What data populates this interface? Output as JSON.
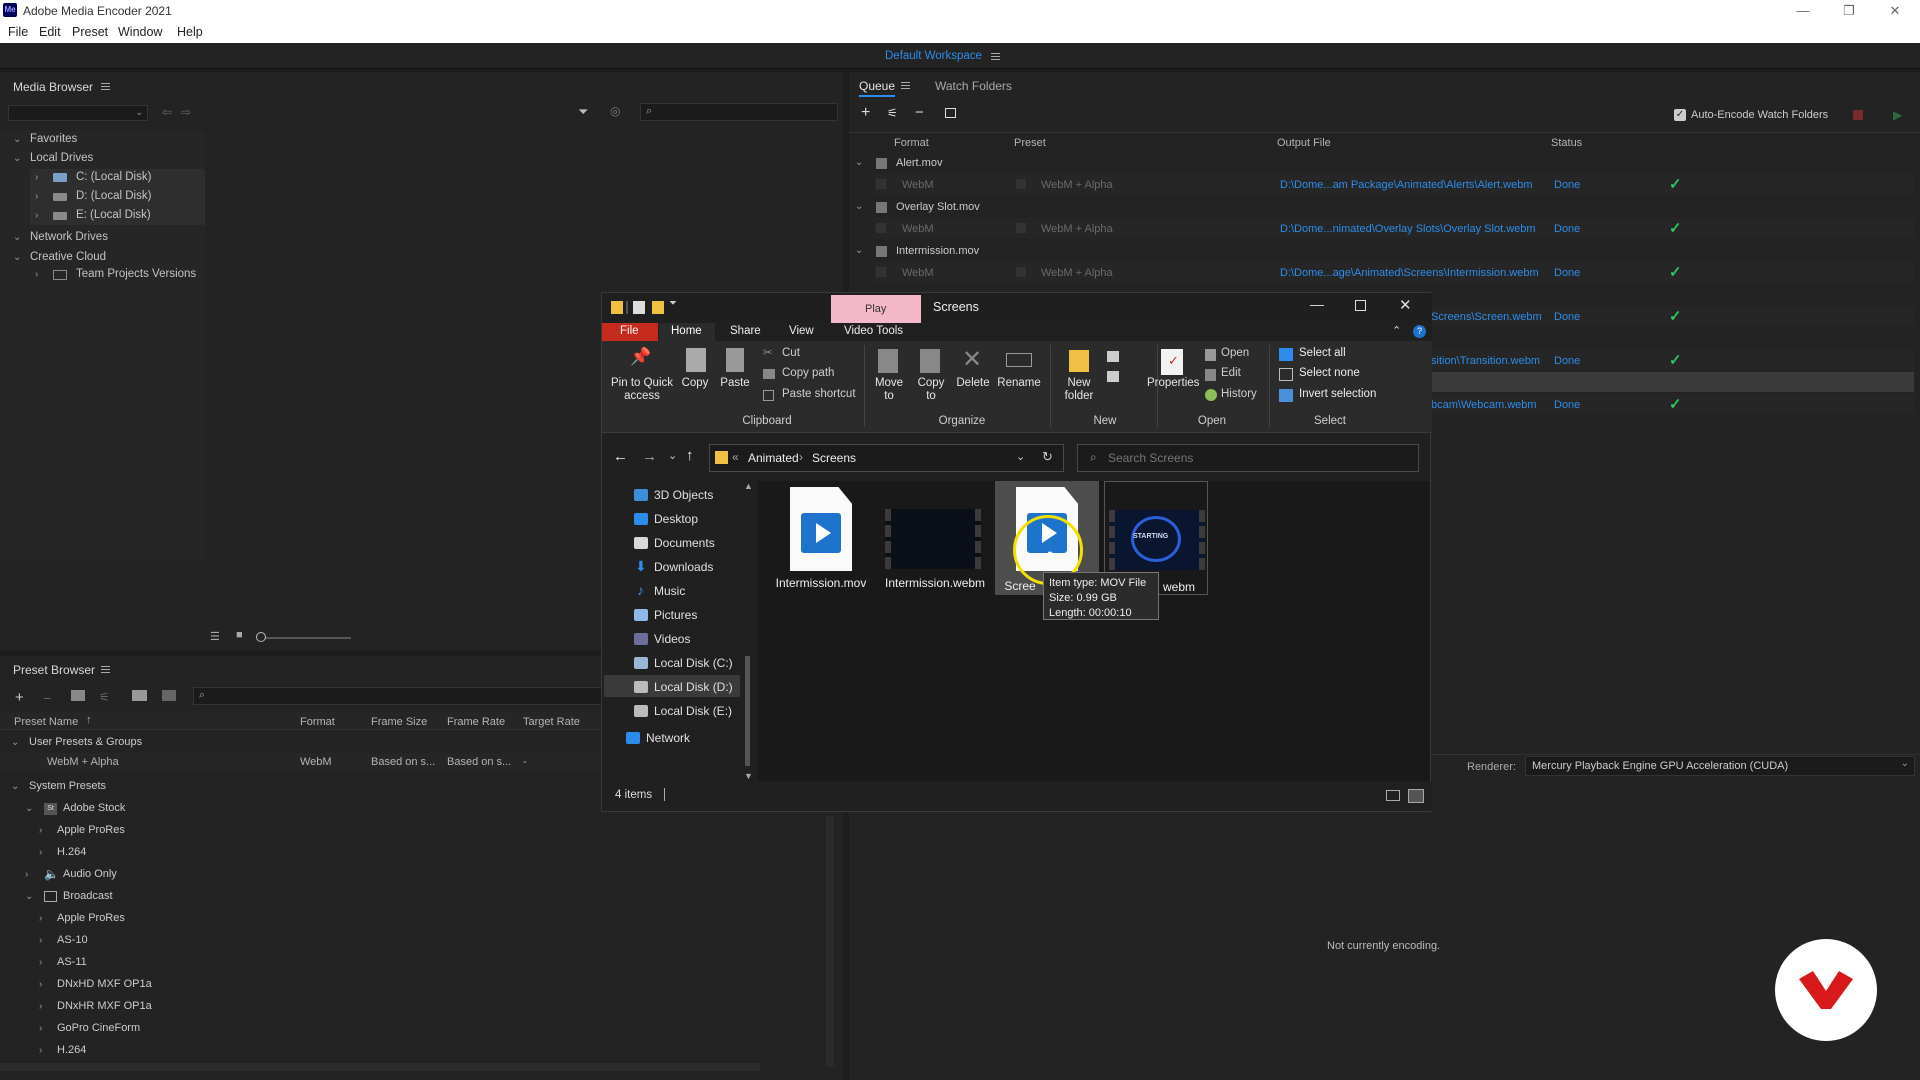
{
  "window": {
    "app_badge": "Me",
    "title": "Adobe Media Encoder 2021",
    "minimize": "—",
    "restore": "❐",
    "close": "✕"
  },
  "menu": [
    "File",
    "Edit",
    "Preset",
    "Window",
    "Help"
  ],
  "workspace": {
    "label": "Default Workspace"
  },
  "media_browser": {
    "title": "Media Browser",
    "favorites": "Favorites",
    "local_drives": "Local Drives",
    "drives": [
      "C: (Local Disk)",
      "D: (Local Disk)",
      "E: (Local Disk)"
    ],
    "network_drives": "Network Drives",
    "creative_cloud": "Creative Cloud",
    "team_projects": "Team Projects Versions"
  },
  "preset_browser": {
    "title": "Preset Browser",
    "columns": [
      "Preset Name",
      "Format",
      "Frame Size",
      "Frame Rate",
      "Target Rate"
    ],
    "user_group": "User Presets & Groups",
    "user_preset": {
      "name": "WebM + Alpha",
      "format": "WebM",
      "frame_size": "Based on s...",
      "frame_rate": "Based on s...",
      "target_rate": "-"
    },
    "system_presets": "System Presets",
    "items": [
      {
        "label": "Adobe Stock",
        "level": 1,
        "expanded": true,
        "icon": "St"
      },
      {
        "label": "Apple ProRes",
        "level": 2
      },
      {
        "label": "H.264",
        "level": 2
      },
      {
        "label": "Audio Only",
        "level": 1,
        "icon": "speaker"
      },
      {
        "label": "Broadcast",
        "level": 1,
        "expanded": true,
        "icon": "tv"
      },
      {
        "label": "Apple ProRes",
        "level": 2
      },
      {
        "label": "AS-10",
        "level": 2
      },
      {
        "label": "AS-11",
        "level": 2
      },
      {
        "label": "DNxHD MXF OP1a",
        "level": 2
      },
      {
        "label": "DNxHR MXF OP1a",
        "level": 2
      },
      {
        "label": "GoPro CineForm",
        "level": 2
      },
      {
        "label": "H.264",
        "level": 2
      }
    ]
  },
  "queue": {
    "tabs": [
      "Queue",
      "Watch Folders"
    ],
    "auto_encode": "Auto-Encode Watch Folders",
    "columns": [
      "Format",
      "Preset",
      "Output File",
      "Status"
    ],
    "items": [
      {
        "source": "Alert.mov",
        "format": "WebM",
        "preset": "WebM + Alpha",
        "output": "D:\\Dome...am Package\\Animated\\Alerts\\Alert.webm",
        "status": "Done"
      },
      {
        "source": "Overlay Slot.mov",
        "format": "WebM",
        "preset": "WebM + Alpha",
        "output": "D:\\Dome...nimated\\Overlay Slots\\Overlay Slot.webm",
        "status": "Done"
      },
      {
        "source": "Intermission.mov",
        "format": "WebM",
        "preset": "WebM + Alpha",
        "output": "D:\\Dome...age\\Animated\\Screens\\Intermission.webm",
        "status": "Done"
      }
    ],
    "partial_rows": [
      {
        "output": "Screens\\Screen.webm",
        "status": "Done"
      },
      {
        "output": "sition\\Transition.webm",
        "status": "Done"
      },
      {
        "output": "bcam\\Webcam.webm",
        "status": "Done"
      }
    ],
    "check": "✓"
  },
  "encoding": {
    "renderer_label": "Renderer:",
    "renderer_value": "Mercury Playback Engine GPU Acceleration (CUDA)",
    "status": "Not currently encoding."
  },
  "explorer": {
    "context_tab": "Play",
    "title": "Screens",
    "tabs": [
      "File",
      "Home",
      "Share",
      "View",
      "Video Tools"
    ],
    "clipboard": {
      "pin": "Pin to Quick access",
      "copy": "Copy",
      "paste": "Paste",
      "cut": "Cut",
      "copy_path": "Copy path",
      "paste_shortcut": "Paste shortcut",
      "group": "Clipboard"
    },
    "organize": {
      "move": "Move to",
      "copy": "Copy to",
      "delete": "Delete",
      "rename": "Rename",
      "group": "Organize"
    },
    "new": {
      "folder": "New folder",
      "group": "New"
    },
    "open": {
      "properties": "Properties",
      "open": "Open",
      "edit": "Edit",
      "history": "History",
      "group": "Open"
    },
    "select": {
      "all": "Select all",
      "none": "Select none",
      "invert": "Invert selection",
      "group": "Select"
    },
    "address": {
      "sep": "«",
      "crumb1": "Animated",
      "arrow": "›",
      "crumb2": "Screens"
    },
    "search_placeholder": "Search Screens",
    "nav": [
      "3D Objects",
      "Desktop",
      "Documents",
      "Downloads",
      "Music",
      "Pictures",
      "Videos",
      "Local Disk (C:)",
      "Local Disk (D:)",
      "Local Disk (E:)"
    ],
    "network": "Network",
    "files": [
      {
        "name": "Intermission.mov"
      },
      {
        "name": "Intermission.webm"
      },
      {
        "name": "Scree"
      },
      {
        "name": "webm",
        "thumb_text": "STARTING"
      }
    ],
    "tooltip": {
      "type": "Item type: MOV File",
      "size": "Size: 0.99 GB",
      "length": "Length: 00:00:10"
    },
    "status": "4 items"
  }
}
